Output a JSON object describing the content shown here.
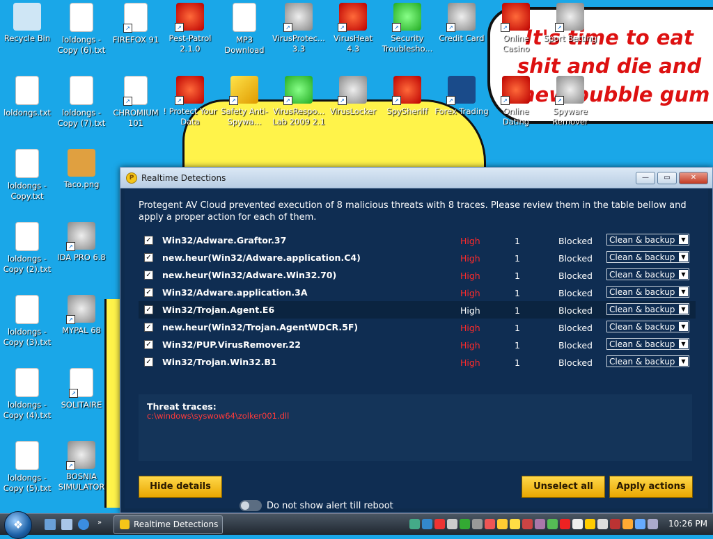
{
  "desktop": {
    "wallpaper_text": "It's time to eat shit and die and chew bubble gum",
    "icons": [
      {
        "label": "Recycle Bin"
      },
      {
        "label": "loldongs - Copy (6).txt"
      },
      {
        "label": "FIREFOX 91"
      },
      {
        "label": "Pest-Patrol 2.1.0"
      },
      {
        "label": "MP3 Download"
      },
      {
        "label": "VirusProtec... 3.3"
      },
      {
        "label": "VirusHeat 4.3"
      },
      {
        "label": "Security Troublesho..."
      },
      {
        "label": "Credit Card"
      },
      {
        "label": "Online Casino"
      },
      {
        "label": "Sport Betting"
      },
      {
        "label": "loldongs.txt"
      },
      {
        "label": "loldongs - Copy (7).txt"
      },
      {
        "label": "CHROMIUM 101"
      },
      {
        "label": "! Protect Your Data"
      },
      {
        "label": "Safety Anti-Spywa..."
      },
      {
        "label": "VirusRespo... Lab 2009 2.1"
      },
      {
        "label": "VirusLocker"
      },
      {
        "label": "SpySheriff"
      },
      {
        "label": "Forex Trading"
      },
      {
        "label": "Online Dating"
      },
      {
        "label": "Spyware Remover"
      },
      {
        "label": "loldongs - Copy.txt"
      },
      {
        "label": "Taco.png"
      },
      {
        "label": "loldongs - Copy (2).txt"
      },
      {
        "label": "IDA PRO 6.8"
      },
      {
        "label": "loldongs - Copy (3).txt"
      },
      {
        "label": "MYPAL 68"
      },
      {
        "label": "loldongs - Copy (4).txt"
      },
      {
        "label": "SOLITAIRE"
      },
      {
        "label": "loldongs - Copy (5).txt"
      },
      {
        "label": "BOSNIA SIMULATOR"
      }
    ]
  },
  "window": {
    "title": "Realtime Detections",
    "message": "Protegent AV Cloud prevented execution of 8 malicious threats with 8 traces. Please review them in the table bellow and apply a proper action for each of them.",
    "threats": [
      {
        "name": "Win32/Adware.Graftor.37",
        "severity": "High",
        "count": "1",
        "status": "Blocked",
        "action": "Clean & backup"
      },
      {
        "name": "new.heur(Win32/Adware.application.C4)",
        "severity": "High",
        "count": "1",
        "status": "Blocked",
        "action": "Clean & backup"
      },
      {
        "name": "new.heur(Win32/Adware.Win32.70)",
        "severity": "High",
        "count": "1",
        "status": "Blocked",
        "action": "Clean & backup"
      },
      {
        "name": "Win32/Adware.application.3A",
        "severity": "High",
        "count": "1",
        "status": "Blocked",
        "action": "Clean & backup"
      },
      {
        "name": "Win32/Trojan.Agent.E6",
        "severity": "High",
        "count": "1",
        "status": "Blocked",
        "action": "Clean & backup"
      },
      {
        "name": "new.heur(Win32/Trojan.AgentWDCR.5F)",
        "severity": "High",
        "count": "1",
        "status": "Blocked",
        "action": "Clean & backup"
      },
      {
        "name": "Win32/PUP.VirusRemover.22",
        "severity": "High",
        "count": "1",
        "status": "Blocked",
        "action": "Clean & backup"
      },
      {
        "name": "Win32/Trojan.Win32.B1",
        "severity": "High",
        "count": "1",
        "status": "Blocked",
        "action": "Clean & backup"
      }
    ],
    "traces_label": "Threat traces:",
    "trace_path": "c:\\windows\\syswow64\\zolker001.dll",
    "hide_details": "Hide details",
    "toggle_label": "Do not show alert till reboot",
    "unselect_all": "Unselect all",
    "apply_actions": "Apply actions"
  },
  "taskbar": {
    "task_label": "Realtime Detections",
    "clock": "10:26 PM"
  }
}
